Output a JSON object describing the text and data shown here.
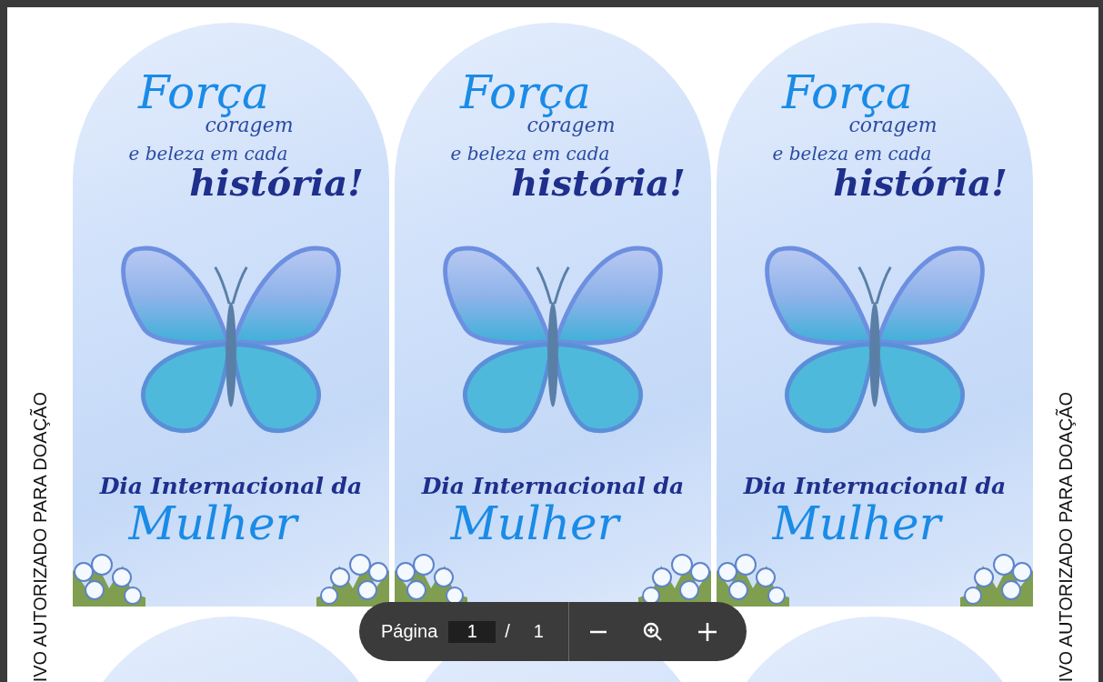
{
  "side_labels": [
    "IVO AUTORIZADO PARA DOAÇÃO",
    "IVO AUTORIZADO PARA DOAÇÃO"
  ],
  "cards": [
    {
      "title": "Força",
      "line_2": "coragem",
      "line_3": "e beleza em cada",
      "line_4": "história!",
      "caption": "Dia Internacional da",
      "caption_2": "Mulher"
    },
    {
      "title": "Força",
      "line_2": "coragem",
      "line_3": "e beleza em cada",
      "line_4": "história!",
      "caption": "Dia Internacional da",
      "caption_2": "Mulher"
    },
    {
      "title": "Força",
      "line_2": "coragem",
      "line_3": "e beleza em cada",
      "line_4": "história!",
      "caption": "Dia Internacional da",
      "caption_2": "Mulher"
    }
  ],
  "toolbar": {
    "page_label": "Página",
    "page_value": "1",
    "separator": "/",
    "page_count": "1"
  }
}
